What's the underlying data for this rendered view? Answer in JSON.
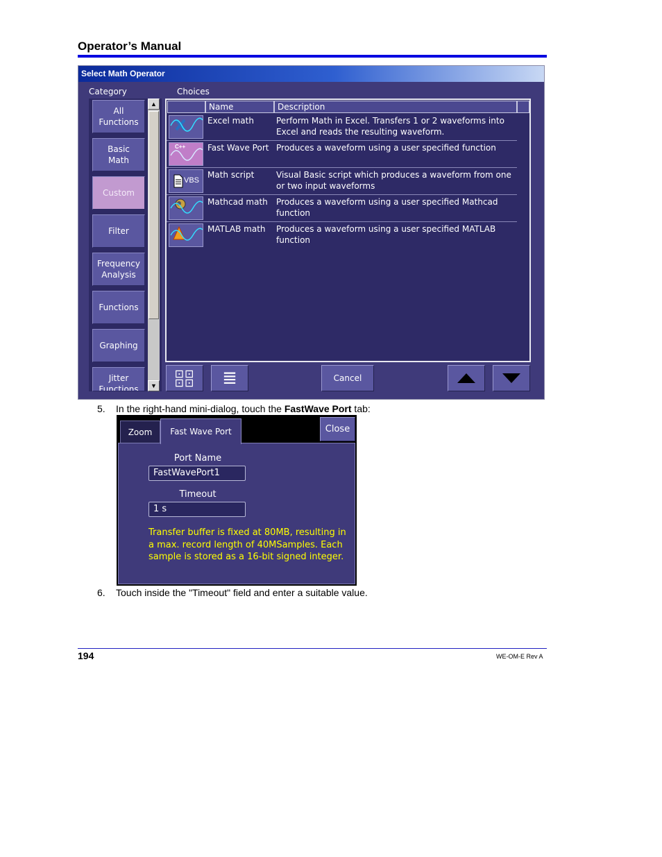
{
  "header": {
    "title": "Operator’s Manual"
  },
  "dialog": {
    "title": "Select Math Operator",
    "category_label": "Category",
    "choices_label": "Choices",
    "categories": [
      {
        "line1": "All",
        "line2": "Functions"
      },
      {
        "line1": "Basic",
        "line2": "Math"
      },
      {
        "line1": "Custom",
        "line2": ""
      },
      {
        "line1": "Filter",
        "line2": ""
      },
      {
        "line1": "Frequency",
        "line2": "Analysis"
      },
      {
        "line1": "Functions",
        "line2": ""
      },
      {
        "line1": "Graphing",
        "line2": ""
      },
      {
        "line1": "Jitter",
        "line2": "Functions"
      }
    ],
    "selected_category": "Custom",
    "columns": {
      "name": "Name",
      "description": "Description"
    },
    "rows": [
      {
        "icon": "excel-wave-icon",
        "name": "Excel math",
        "description": "Perform Math in Excel. Transfers 1 or 2 waveforms into Excel and reads the resulting waveform."
      },
      {
        "icon": "cpp-wave-icon",
        "name": "Fast Wave Port",
        "description": "Produces a waveform using a user specified function"
      },
      {
        "icon": "vbs-script-icon",
        "name": "Math script",
        "description": "Visual Basic script which produces a waveform from one or two input waveforms"
      },
      {
        "icon": "mathcad-wave-icon",
        "name": "Mathcad math",
        "description": "Produces a waveform using a user specified Mathcad function"
      },
      {
        "icon": "matlab-wave-icon",
        "name": "MATLAB math",
        "description": "Produces a waveform using a user specified MATLAB function"
      }
    ],
    "cancel_label": "Cancel",
    "icon_view_glyph": "⊡⊡",
    "list_view_glyph": "≣",
    "vbs_label": "VBS",
    "cpp_label": "C++"
  },
  "step5": {
    "number": "5.",
    "before": "In the right-hand mini-dialog, touch the ",
    "bold": "FastWave Port",
    "after": " tab:"
  },
  "mini_dialog": {
    "tabs": [
      "Zoom",
      "Fast Wave Port"
    ],
    "close_label": "Close",
    "port_name_label": "Port Name",
    "port_name_value": "FastWavePort1",
    "timeout_label": "Timeout",
    "timeout_value": "1 s",
    "note": "Transfer buffer is fixed at 80MB, resulting in a max. record length of 40MSamples. Each sample is stored as a 16-bit signed integer."
  },
  "step6": {
    "number": "6.",
    "text": "Touch inside the \"Timeout\" field and enter a suitable value."
  },
  "footer": {
    "page_number": "194",
    "revision": "WE-OM-E Rev A"
  },
  "colors": {
    "rule": "#0000e0",
    "panel": "#3f3a7a",
    "selected": "#c29ad0",
    "note": "#ffff00"
  }
}
